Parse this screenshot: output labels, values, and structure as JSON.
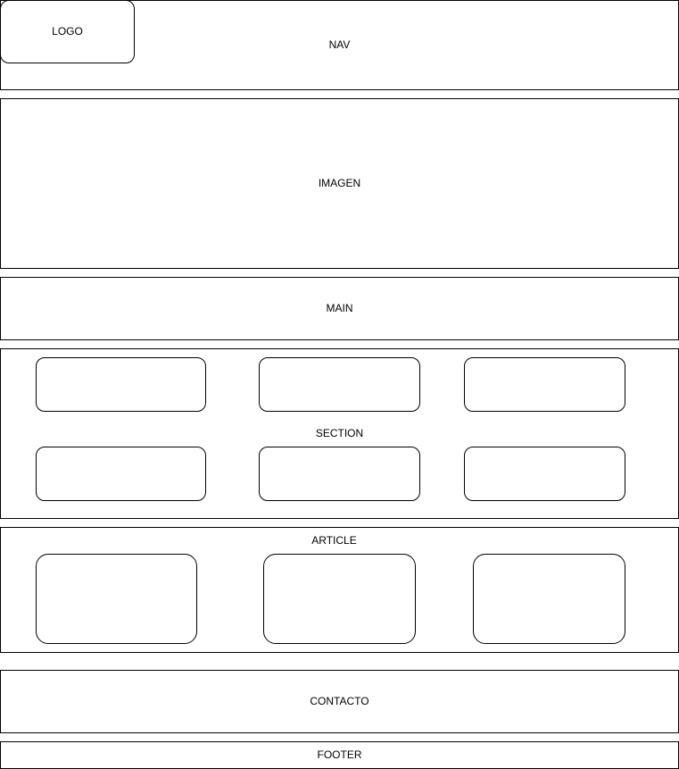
{
  "wireframe": {
    "logo": "LOGO",
    "nav": "NAV",
    "imagen": "IMAGEN",
    "main": "MAIN",
    "section": "SECTION",
    "article": "ARTICLE",
    "contacto": "CONTACTO",
    "footer": "FOOTER"
  }
}
